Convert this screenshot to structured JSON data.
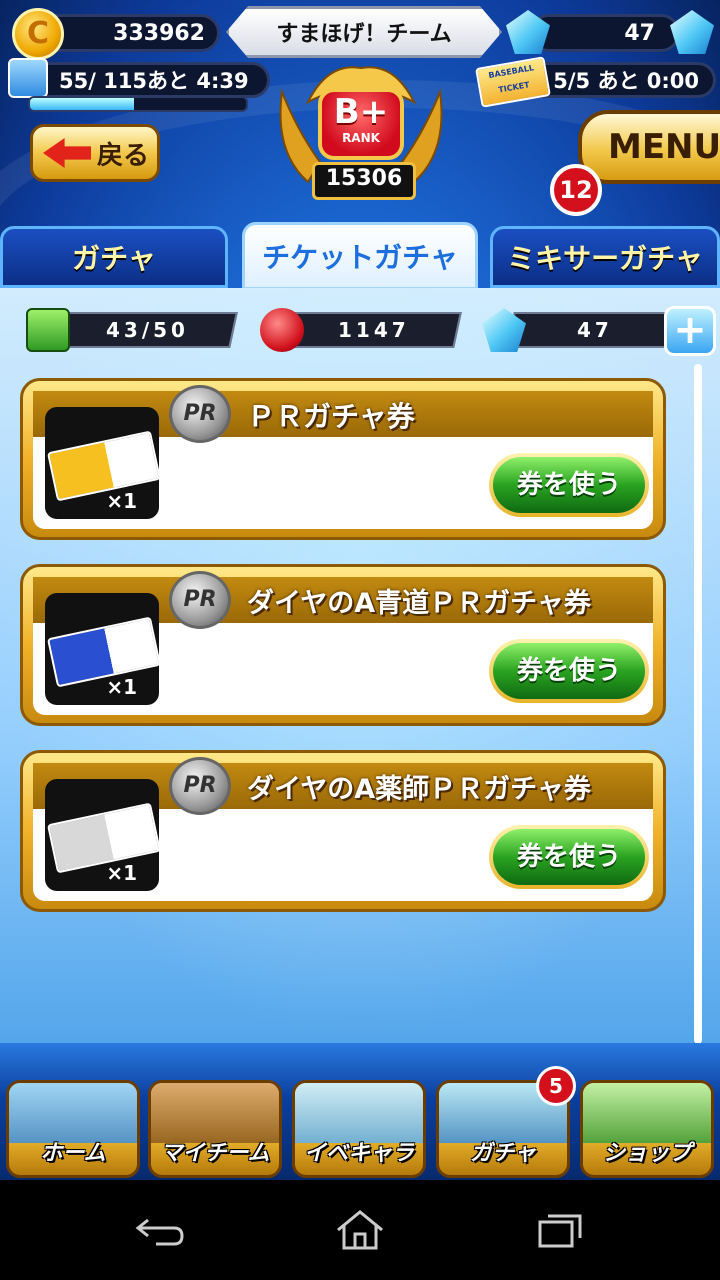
{
  "status": {
    "coins": "333962",
    "team_name": "すまほげ！チーム",
    "diamonds": "47",
    "stamina": "55/ 115あと 4:39",
    "stamina_fraction": 0.48,
    "tickets": "5/5 あと 0:00",
    "ticket_icon_text": "BASEBALL TICKET"
  },
  "rank": {
    "letter": "B+",
    "label": "RANK",
    "score": "15306"
  },
  "header": {
    "back_label": "戻る",
    "menu_label": "MENU",
    "menu_badge": "12"
  },
  "tabs": [
    {
      "label": "ガチャ",
      "active": false
    },
    {
      "label": "チケットガチャ",
      "active": true
    },
    {
      "label": "ミキサーガチャ",
      "active": false
    }
  ],
  "currencies": {
    "chest": "43/50",
    "red_ball": "1147",
    "diamond": "47"
  },
  "gacha_items": [
    {
      "title": "ＰＲガチャ券",
      "count": "×1",
      "button": "券を使う",
      "pr": "PR"
    },
    {
      "title": "ダイヤのA青道ＰＲガチャ券",
      "count": "×1",
      "button": "券を使う",
      "pr": "PR"
    },
    {
      "title": "ダイヤのA薬師ＰＲガチャ券",
      "count": "×1",
      "button": "券を使う",
      "pr": "PR"
    }
  ],
  "bottom_nav": [
    {
      "label": "ホーム"
    },
    {
      "label": "マイチーム"
    },
    {
      "label": "イベキャラ"
    },
    {
      "label": "ガチャ"
    },
    {
      "label": "ショップ"
    }
  ],
  "gacha_badge": "5",
  "colors": {
    "accent_gold": "#f0b22a",
    "button_green": "#2aa320",
    "badge_red": "#d4101d",
    "tab_active_text": "#1d6fe0"
  }
}
